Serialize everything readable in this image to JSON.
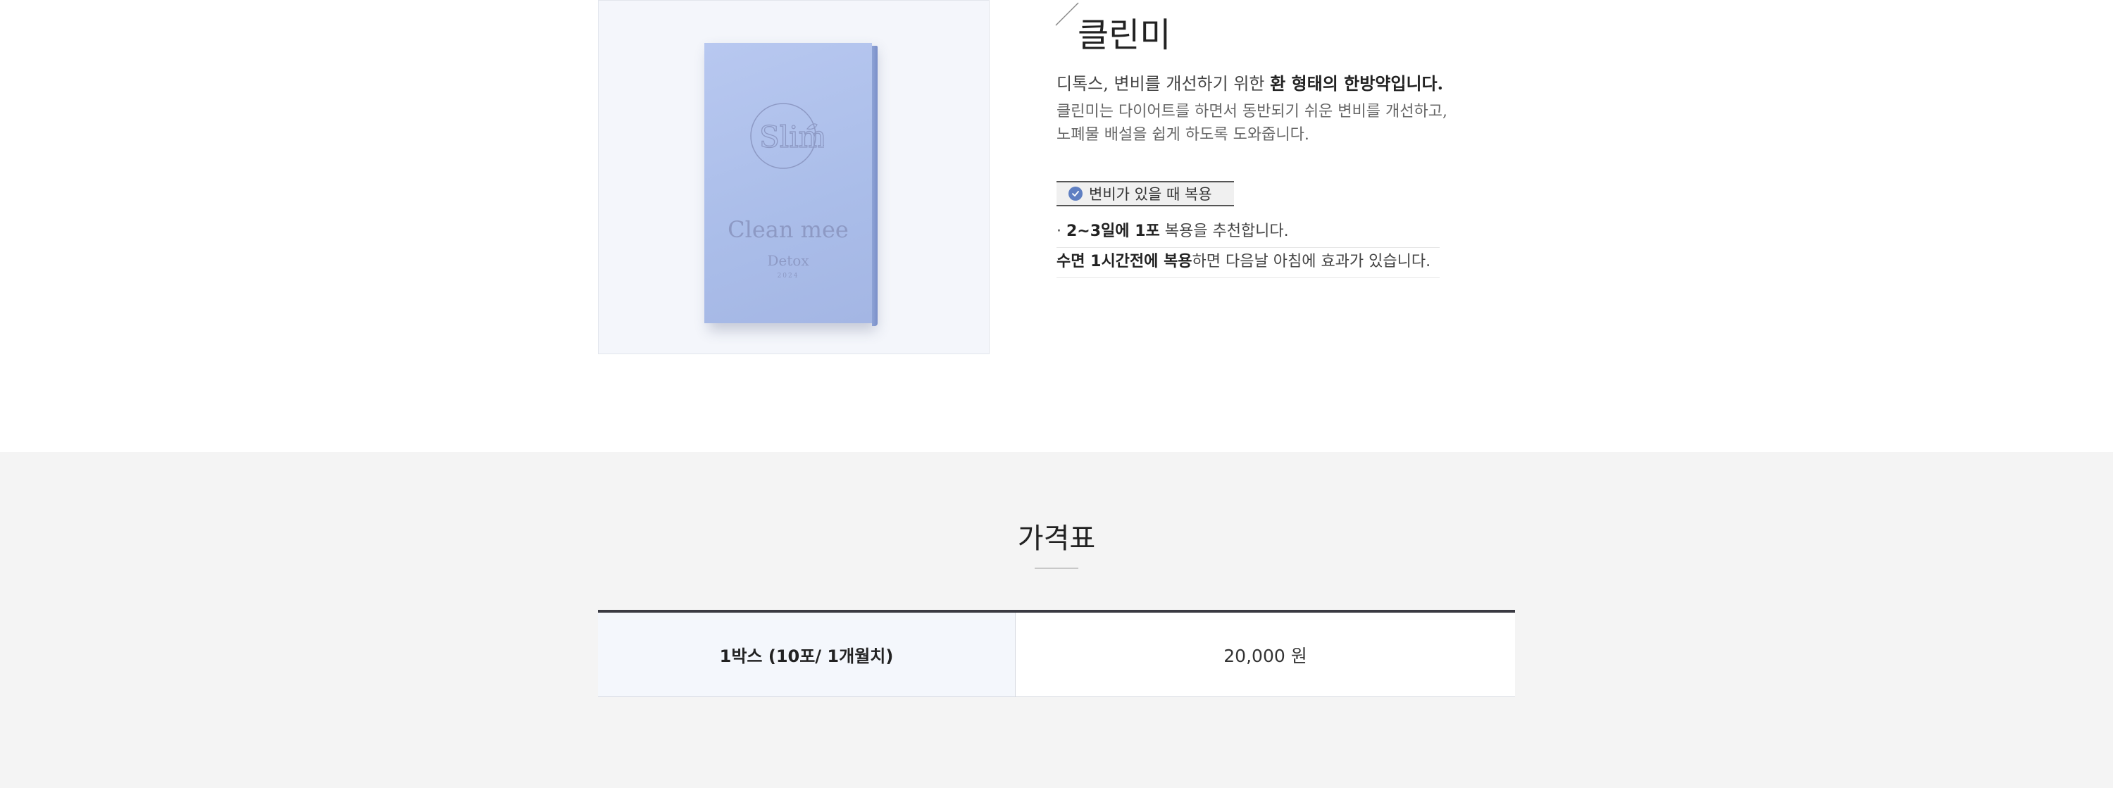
{
  "product": {
    "image_alt": "Clean mee Detox box",
    "box_brand": "Clean mee",
    "box_sub": "Detox",
    "box_sub2": "2024",
    "logo_text": "Slim",
    "name": "클린미",
    "desc_lead_prefix": "디톡스, 변비를 개선하기 위한 ",
    "desc_lead_bold": "환 형태의 한방약입니다.",
    "desc_body_line1": "클린미는 다이어트를 하면서 동반되기 쉬운 변비를 개선하고,",
    "desc_body_line2": "노폐물 배설을 쉽게 하도록 도와줍니다.",
    "badge": "변비가 있을 때 복용",
    "usage": [
      {
        "prefix": "· ",
        "bold": "2~3일에 1포",
        "rest": " 복용을 추천합니다."
      },
      {
        "prefix": "",
        "bold": "수면 1시간전에 복용",
        "rest": "하면 다음날 아침에 효과가 있습니다."
      }
    ]
  },
  "pricing": {
    "title": "가격표",
    "rows": [
      {
        "label": "1박스 (10포/ 1개월치)",
        "price": "20,000 원"
      }
    ]
  },
  "colors": {
    "accent": "#5f7fc2",
    "box": "#aabde9",
    "section_bg": "#f4f4f4"
  }
}
